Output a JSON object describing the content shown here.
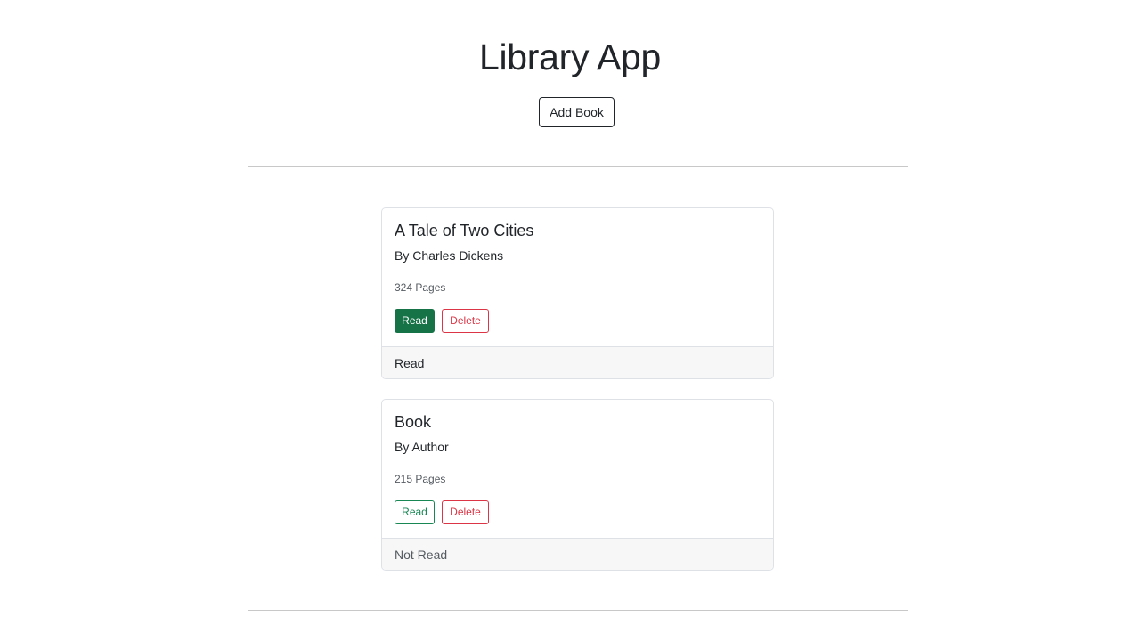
{
  "header": {
    "title": "Library App",
    "add_book_label": "Add Book"
  },
  "books": [
    {
      "title": "A Tale of Two Cities",
      "author_line": "By Charles Dickens",
      "pages_line": "324 Pages",
      "read_button_label": "Read",
      "delete_button_label": "Delete",
      "status": "Read",
      "is_read": true
    },
    {
      "title": "Book",
      "author_line": "By Author",
      "pages_line": "215 Pages",
      "read_button_label": "Read",
      "delete_button_label": "Delete",
      "status": "Not Read",
      "is_read": false
    }
  ],
  "colors": {
    "read_active": "#157347",
    "read_outline": "#198754",
    "delete_outline": "#dc3545"
  }
}
